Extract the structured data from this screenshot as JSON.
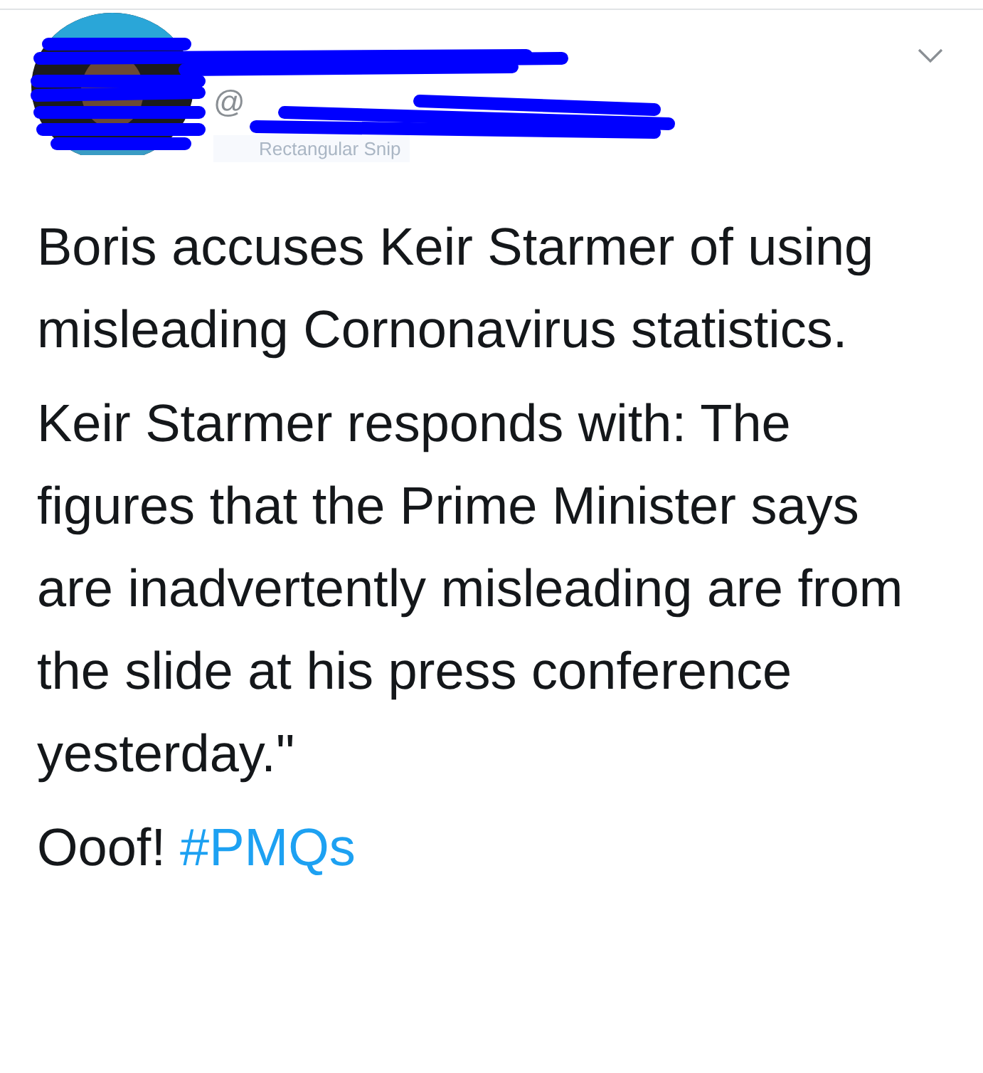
{
  "tweet": {
    "handle": "@",
    "snip_tooltip": "Rectangular Snip",
    "paragraphs": [
      "Boris accuses Keir Starmer of using misleading Cornonavirus statistics.",
      "Keir Starmer responds with: The figures that the Prime Minister says are inadvertently misleading are from the slide at his press conference yesterday.\""
    ],
    "last_line": {
      "text": "Ooof!",
      "hashtag": "#PMQs"
    }
  }
}
